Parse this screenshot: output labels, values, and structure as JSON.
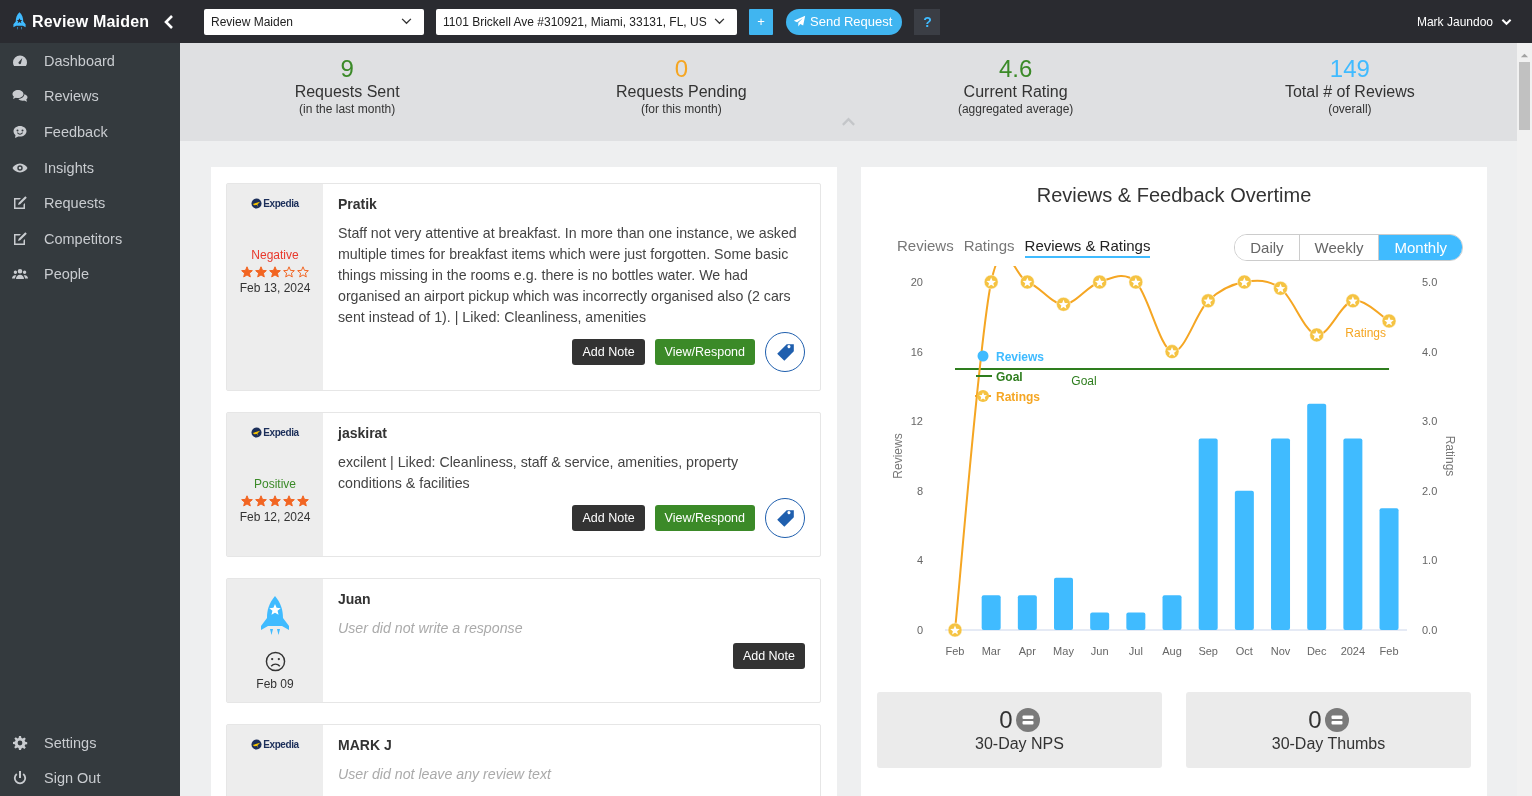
{
  "topbar": {
    "brand": "Review Maiden",
    "business_select": {
      "value": "Review Maiden"
    },
    "location_select": {
      "value": "1101 Brickell Ave #310921, Miami, 33131, FL, US"
    },
    "add_button": "+",
    "send_button": "Send Request",
    "help_button": "?",
    "user": "Mark Jaundoo"
  },
  "sidebar": {
    "items": [
      {
        "label": "Dashboard"
      },
      {
        "label": "Reviews"
      },
      {
        "label": "Feedback"
      },
      {
        "label": "Insights"
      },
      {
        "label": "Requests"
      },
      {
        "label": "Competitors"
      },
      {
        "label": "People"
      }
    ],
    "bottom_items": [
      {
        "label": "Settings"
      },
      {
        "label": "Sign Out"
      }
    ]
  },
  "stats": [
    {
      "value": "9",
      "label": "Requests Sent",
      "note": "(in the last month)",
      "color": "#3b8a28"
    },
    {
      "value": "0",
      "label": "Requests Pending",
      "note": "(for this month)",
      "color": "#f5a623"
    },
    {
      "value": "4.6",
      "label": "Current Rating",
      "note": "(aggregated average)",
      "color": "#3b8a28"
    },
    {
      "value": "149",
      "label": "Total # of Reviews",
      "note": "(overall)",
      "color": "#40bbff"
    }
  ],
  "reviews": [
    {
      "kind": "site",
      "source_label": "Expedia",
      "sentiment": "Negative",
      "color": "#e8382b",
      "stars": 3,
      "date": "Feb 13, 2024",
      "name": "Pratik",
      "text": "Staff not very attentive at breakfast. In more than one instance, we asked multiple times for breakfast items which were just forgotten. Some basic things missing in the rooms e.g. there is no bottles water. We had organised an airport pickup which was incorrectly organised also (2 cars sent instead of 1). | Liked: Cleanliness, amenities",
      "text_missing": false,
      "add_note": "Add Note",
      "respond": "View/Respond",
      "tag_button": true
    },
    {
      "kind": "site",
      "source_label": "Expedia",
      "sentiment": "Positive",
      "color": "#3b8a28",
      "stars": 5,
      "date": "Feb 12, 2024",
      "name": "jaskirat",
      "text": "excilent | Liked: Cleanliness, staff & service, amenities, property conditions & facilities",
      "text_missing": false,
      "add_note": "Add Note",
      "respond": "View/Respond",
      "tag_button": true
    },
    {
      "kind": "app",
      "date": "Feb 09",
      "name": "Juan",
      "text": "User did not write a response",
      "text_missing": true,
      "add_note": "Add Note",
      "tag_button": false
    },
    {
      "kind": "site",
      "source_label": "Expedia",
      "name": "MARK J",
      "text": "User did not leave any review text",
      "text_missing": true,
      "tag_button": false
    }
  ],
  "chart_panel": {
    "title": "Reviews & Feedback Overtime",
    "view_tabs": [
      {
        "label": "Reviews",
        "selected": false
      },
      {
        "label": "Ratings",
        "selected": false
      },
      {
        "label": "Reviews & Ratings",
        "selected": true
      }
    ],
    "period_tabs": [
      {
        "label": "Daily",
        "selected": false
      },
      {
        "label": "Weekly",
        "selected": false
      },
      {
        "label": "Monthly",
        "selected": true
      }
    ],
    "chart_data": {
      "type": "bar",
      "categories": [
        "Feb",
        "Mar",
        "Apr",
        "May",
        "Jun",
        "Jul",
        "Aug",
        "Sep",
        "Oct",
        "Nov",
        "Dec",
        "2024",
        "Feb"
      ],
      "ylabel": "Reviews",
      "ylim": [
        0,
        20
      ],
      "yticks": [
        0,
        4,
        8,
        12,
        16,
        20
      ],
      "y2label": "Ratings",
      "y2lim": [
        0,
        5
      ],
      "y2ticks": [
        {
          "value": 0,
          "label": "0.0"
        },
        {
          "value": 1,
          "label": "1.0"
        },
        {
          "value": 2,
          "label": "2.0"
        },
        {
          "value": 3,
          "label": "3.0"
        },
        {
          "value": 4,
          "label": "4.0"
        },
        {
          "value": 5,
          "label": "5.0"
        }
      ],
      "series": [
        {
          "name": "Reviews",
          "type": "bar",
          "color": "#40bbff",
          "values": [
            0,
            2,
            2,
            3,
            1,
            1,
            2,
            11,
            8,
            11,
            13,
            11,
            7
          ]
        },
        {
          "name": "Goal",
          "type": "line",
          "color": "#2e7d1e",
          "values": [
            15,
            15,
            15,
            15,
            15,
            15,
            15,
            15,
            15,
            15,
            15,
            15,
            15
          ]
        },
        {
          "name": "Ratings",
          "type": "line",
          "axis": "y2",
          "marker": "circle",
          "color": "#f5a623",
          "values": [
            0,
            5,
            5,
            4.68,
            5,
            5,
            4,
            4.73,
            5,
            4.91,
            4.24,
            4.73,
            4.44
          ]
        }
      ],
      "legend": "upper left",
      "annotations": [
        {
          "text": "Goal",
          "x": "Jun",
          "y": 15
        },
        "Ratings"
      ]
    }
  },
  "kpis": [
    {
      "value": "0",
      "label": "30-Day NPS"
    },
    {
      "value": "0",
      "label": "30-Day Thumbs"
    }
  ]
}
